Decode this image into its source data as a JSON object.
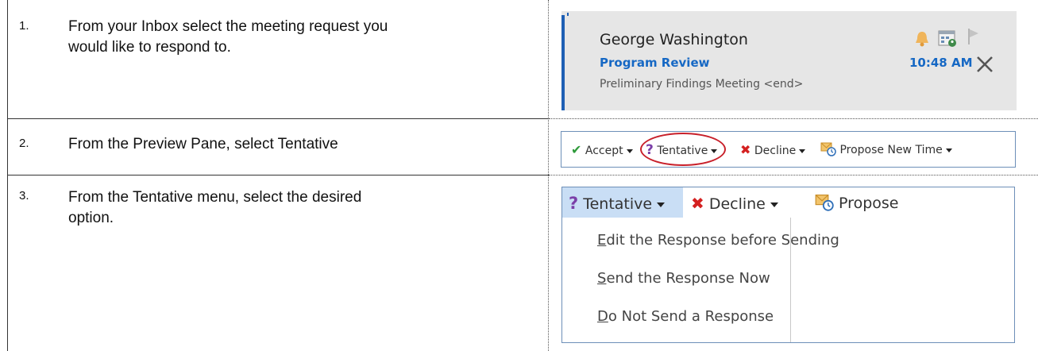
{
  "steps": [
    {
      "number": "1.",
      "lines": [
        "From your Inbox select the meeting request you",
        "would like to respond to."
      ]
    },
    {
      "number": "2.",
      "lines": [
        "From the Preview Pane, select Tentative"
      ]
    },
    {
      "number": "3.",
      "lines": [
        "From the Tentative menu, select the desired",
        "option."
      ]
    }
  ],
  "email": {
    "sender": "George Washington",
    "subject": "Program Review",
    "preview": "Preliminary Findings Meeting <end>",
    "time": "10:48 AM",
    "icons": [
      "bell-icon",
      "calendar-icon",
      "flag-icon",
      "close-icon"
    ]
  },
  "toolbar": {
    "accept": "Accept",
    "tentative": "Tentative",
    "decline": "Decline",
    "propose": "Propose New Time"
  },
  "menu": {
    "tentative": "Tentative",
    "decline": "Decline",
    "propose": "Propose",
    "options": [
      {
        "accel": "E",
        "rest": "dit the Response before Sending"
      },
      {
        "accel": "S",
        "rest": "end the Response Now"
      },
      {
        "accel": "D",
        "rest": "o Not Send a Response"
      }
    ]
  },
  "colors": {
    "accent_blue": "#1668c4",
    "highlight_red": "#c8202a",
    "accept_green": "#2e9a3a",
    "decline_red": "#d42020",
    "tentative_purple": "#7b3fa8",
    "menu_highlight": "#c9def5"
  }
}
